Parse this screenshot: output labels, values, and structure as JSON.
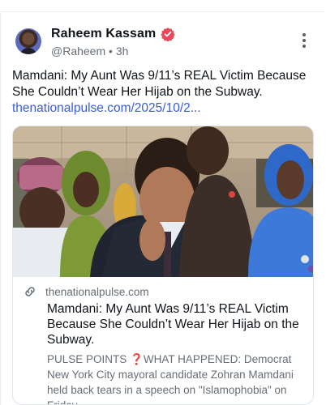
{
  "post": {
    "author_name": "Raheem Kassam",
    "handle": "@Raheem",
    "separator": "•",
    "time": "3h",
    "text": "Mamdani: My Aunt Was 9/11’s REAL Victim Because She Couldn’t Wear Her Hijab on the Subway.",
    "link_text": "thenationalpulse.com/2025/10/2..."
  },
  "card": {
    "domain": "thenationalpulse.com",
    "title": "Mamdani: My Aunt Was 9/11’s REAL Victim Because She Couldn’t Wear Her Hijab on the Subway.",
    "desc_prefix": "PULSE POINTS",
    "desc_mark": "❓",
    "desc_body": "WHAT HAPPENED: Democrat New York City mayoral candidate Zohran Mamdani held back tears in a speech on \"Islamophobia\" on Friday,"
  },
  "icons": {
    "verified": "verified-badge-icon",
    "more": "more-vertical-icon",
    "link": "link-icon"
  },
  "colors": {
    "link": "#3b5bdb",
    "verified": "#e8485a",
    "muted": "#666e76"
  }
}
